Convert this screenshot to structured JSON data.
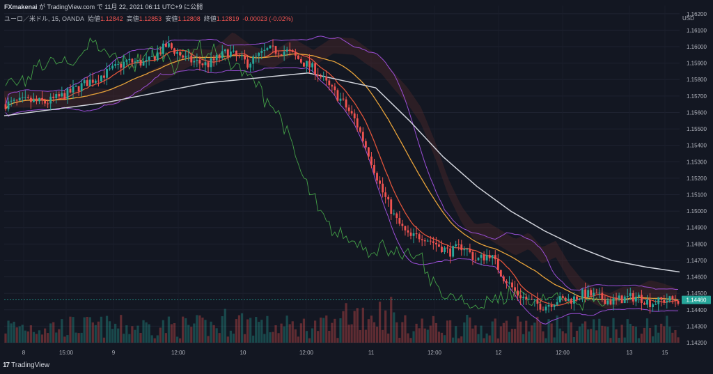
{
  "header": {
    "publisher": "FXmakenai",
    "published_text": "が TradingView.com で 11月 22, 2021 06:11 UTC+9 に公開"
  },
  "symbol_line": {
    "name": "ユーロ／米ドル, 15, OANDA",
    "open_label": "始値",
    "open": "1.12842",
    "high_label": "高値",
    "high": "1.12853",
    "low_label": "安値",
    "low": "1.12808",
    "close_label": "終値",
    "close": "1.12819",
    "change": "-0.00023 (-0.02%)"
  },
  "price_scale": {
    "currency": "USD",
    "ticks": [
      "1.16200",
      "1.16100",
      "1.16000",
      "1.15900",
      "1.15800",
      "1.15700",
      "1.15600",
      "1.15500",
      "1.15400",
      "1.15300",
      "1.15200",
      "1.15100",
      "1.15000",
      "1.14900",
      "1.14800",
      "1.14700",
      "1.14600",
      "1.14500",
      "1.14400",
      "1.14300",
      "1.14200"
    ],
    "last_price": "1.14460"
  },
  "time_axis": [
    "8",
    "15:00",
    "9",
    "12:00",
    "10",
    "12:00",
    "11",
    "12:00",
    "12",
    "12:00",
    "13",
    "15"
  ],
  "branding": "TradingView",
  "colors": {
    "background": "#131722",
    "up": "#26a69a",
    "down": "#ef5350",
    "last_price_badge": "#26a69a",
    "ma_white": "#d1d4dc",
    "ma_orange": "#e8a33a",
    "ma_red": "#e0543a",
    "bollinger": "#9c4fd9",
    "chikou": "#43a047"
  },
  "chart_data": {
    "type": "candlestick",
    "symbol": "ユーロ／米ドル, 15, OANDA",
    "ylim": [
      1.142,
      1.1625
    ],
    "x_ticks": [
      "8",
      "15:00",
      "9",
      "12:00",
      "10",
      "12:00",
      "11",
      "12:00",
      "12",
      "12:00",
      "13",
      "15"
    ],
    "price_path": [
      [
        0,
        1.1565
      ],
      [
        3,
        1.1567
      ],
      [
        6,
        1.1566
      ],
      [
        9,
        1.1571
      ],
      [
        12,
        1.1578
      ],
      [
        15,
        1.1584
      ],
      [
        18,
        1.1591
      ],
      [
        21,
        1.159
      ],
      [
        24,
        1.1601
      ],
      [
        27,
        1.1592
      ],
      [
        30,
        1.1589
      ],
      [
        33,
        1.1597
      ],
      [
        36,
        1.159
      ],
      [
        39,
        1.1598
      ],
      [
        42,
        1.1597
      ],
      [
        44,
        1.1591
      ],
      [
        46,
        1.1586
      ],
      [
        48,
        1.1576
      ],
      [
        50,
        1.1567
      ],
      [
        52,
        1.1555
      ],
      [
        54,
        1.1535
      ],
      [
        56,
        1.1512
      ],
      [
        58,
        1.1495
      ],
      [
        60,
        1.1484
      ],
      [
        62,
        1.1485
      ],
      [
        64,
        1.148
      ],
      [
        66,
        1.1475
      ],
      [
        68,
        1.1479
      ],
      [
        70,
        1.147
      ],
      [
        72,
        1.1474
      ],
      [
        74,
        1.146
      ],
      [
        76,
        1.145
      ],
      [
        78,
        1.1445
      ],
      [
        80,
        1.1442
      ],
      [
        82,
        1.1446
      ],
      [
        84,
        1.1446
      ],
      [
        86,
        1.145
      ],
      [
        88,
        1.1448
      ],
      [
        90,
        1.1445
      ],
      [
        92,
        1.1447
      ],
      [
        94,
        1.1448
      ],
      [
        96,
        1.1444
      ],
      [
        98,
        1.1446
      ],
      [
        100,
        1.1446
      ]
    ],
    "ma_white_path": [
      [
        0,
        1.1558
      ],
      [
        15,
        1.1566
      ],
      [
        30,
        1.1578
      ],
      [
        45,
        1.1584
      ],
      [
        55,
        1.1575
      ],
      [
        60,
        1.1555
      ],
      [
        65,
        1.1533
      ],
      [
        70,
        1.1515
      ],
      [
        75,
        1.15
      ],
      [
        80,
        1.1488
      ],
      [
        85,
        1.1478
      ],
      [
        90,
        1.147
      ],
      [
        95,
        1.1466
      ],
      [
        100,
        1.1463
      ]
    ],
    "last_close": 1.1446
  }
}
